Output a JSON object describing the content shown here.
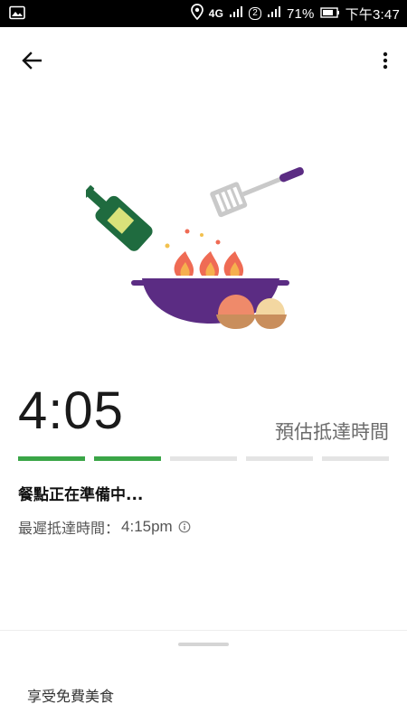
{
  "status_bar": {
    "network": "4G",
    "sim": "2",
    "battery": "71%",
    "time": "下午3:47"
  },
  "order": {
    "eta_time": "4:05",
    "eta_label": "預估抵達時間",
    "progress": {
      "completed_steps": 2,
      "total_steps": 5
    },
    "status_text": "餐點正在準備中...",
    "latest_arrival_label": "最遲抵達時間：",
    "latest_arrival_value": "4:15pm"
  },
  "bottom_sheet": {
    "title": "享受免費美食"
  },
  "colors": {
    "progress_done": "#3aa547",
    "progress_pending": "#e4e4e4",
    "pan": "#5b2c83",
    "bottle": "#1f6b3f",
    "flame": "#ef6b54"
  },
  "icons": {
    "back": "arrow-left-icon",
    "more": "more-vert-icon",
    "info": "info-icon"
  }
}
